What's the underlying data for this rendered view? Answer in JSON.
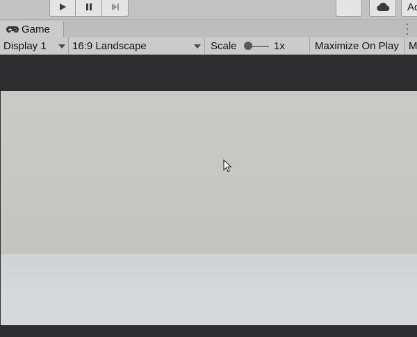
{
  "toolbar": {
    "play_icon": "play-icon",
    "pause_icon": "pause-icon",
    "step_icon": "step-icon",
    "cloud_icon": "cloud-icon",
    "account_label": "Ac"
  },
  "game_tab": {
    "label": "Game",
    "icon": "gamepad-icon"
  },
  "controls": {
    "display": "Display 1",
    "aspect": "16:9 Landscape",
    "scale_label": "Scale",
    "scale_value": "1x",
    "maximize_on_play": "Maximize On Play",
    "truncated": "M"
  },
  "colors": {
    "editor_bg": "#c2c2c2",
    "viewport_letterbox": "#2d2d2f",
    "sky": "#c6c7c2",
    "ground": "#d5d6d8"
  }
}
